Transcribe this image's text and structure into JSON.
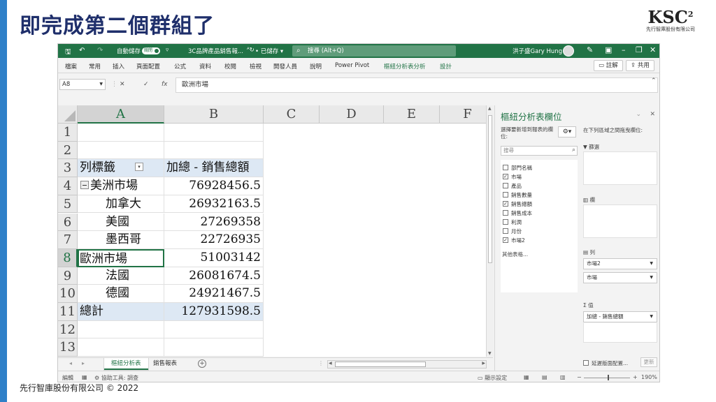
{
  "slide": {
    "title": "即完成第二個群組了",
    "logo_text": "KSC",
    "logo_sup": "2",
    "logo_sub": "先行智庫股份有限公司",
    "footer": "先行智庫股份有限公司 © 2022"
  },
  "titlebar": {
    "autosave_label": "自動儲存",
    "autosave_state": "關閉",
    "filename": "3C品牌產品銷售報...",
    "saved_status": "• 已儲存 ▾",
    "search_placeholder": "搜尋 (Alt+Q)",
    "user_name": "洪子盛Gary Hung"
  },
  "menu": {
    "items": [
      "檔案",
      "常用",
      "插入",
      "頁面配置",
      "公式",
      "資料",
      "校閱",
      "檢視",
      "開發人員",
      "說明",
      "Power Pivot",
      "樞紐分析表分析",
      "設計"
    ],
    "comment_label": "註解",
    "share_label": "共用"
  },
  "formula": {
    "name_box": "A8",
    "content": "歐洲市場"
  },
  "grid": {
    "columns": [
      "A",
      "B",
      "C",
      "D",
      "E",
      "F"
    ],
    "rows": [
      "1",
      "2",
      "3",
      "4",
      "5",
      "6",
      "7",
      "8",
      "9",
      "10",
      "11",
      "12",
      "13"
    ],
    "pivot": {
      "header_label": "列標籤",
      "header_value": "加總 - 銷售總額",
      "r4_label": "美洲市場",
      "r4_value": "76928456.5",
      "r5_label": "加拿大",
      "r5_value": "26932163.5",
      "r6_label": "美國",
      "r6_value": "27269358",
      "r7_label": "墨西哥",
      "r7_value": "22726935",
      "r8_label": "歐洲市場",
      "r8_value": "51003142",
      "r9_label": "法國",
      "r9_value": "26081674.5",
      "r10_label": "德國",
      "r10_value": "24921467.5",
      "r11_label": "總計",
      "r11_value": "127931598.5"
    }
  },
  "sheets": {
    "tabs": [
      "樞紐分析表",
      "銷售報表"
    ],
    "active": 0
  },
  "status": {
    "mode": "編輯",
    "accessibility": "協助工具: 調查",
    "display_settings": "顯示設定",
    "zoom": "190%"
  },
  "pane": {
    "title": "樞紐分析表欄位",
    "choose_fields": "選擇要新增到報表的欄位:",
    "search_placeholder": "搜尋",
    "fields": [
      {
        "name": "部門名稱",
        "checked": false
      },
      {
        "name": "市場",
        "checked": true
      },
      {
        "name": "產品",
        "checked": false
      },
      {
        "name": "銷售數量",
        "checked": false
      },
      {
        "name": "銷售總額",
        "checked": true
      },
      {
        "name": "銷售成本",
        "checked": false
      },
      {
        "name": "利潤",
        "checked": false
      },
      {
        "name": "月份",
        "checked": false
      },
      {
        "name": "市場2",
        "checked": true
      }
    ],
    "more_tables": "其他表格...",
    "drag_hint": "在下列區域之間拖曳欄位:",
    "filters_label": "篩選",
    "columns_label": "欄",
    "rows_label": "列",
    "rows_items": [
      "市場2",
      "市場"
    ],
    "values_label": "值",
    "values_items": [
      "加總 - 銷售總額"
    ],
    "defer_label": "延遲版面配置...",
    "update_label": "更新"
  }
}
